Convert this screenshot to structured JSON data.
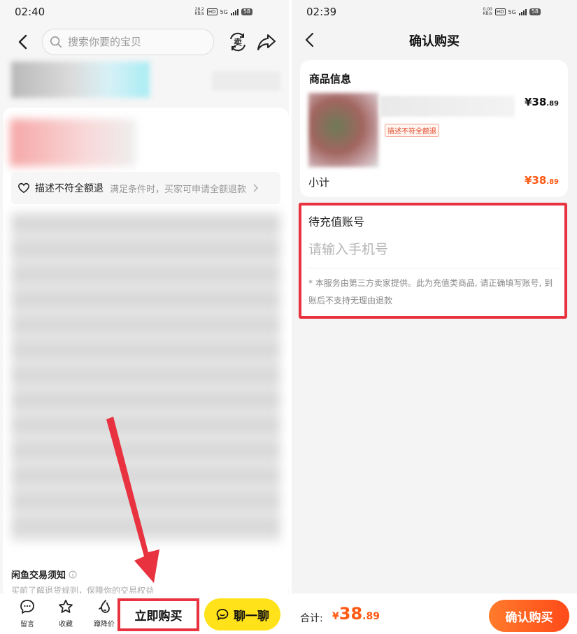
{
  "left": {
    "status": {
      "time": "02:40",
      "speed_top": "28.2",
      "speed_bottom": "KB/s",
      "hd": "HD",
      "net": "5G",
      "battery": "58"
    },
    "search": {
      "placeholder": "搜索你要的宝贝"
    },
    "refund": {
      "title": "描述不符全额退",
      "subtitle": "满足条件时，买家可申请全额退款"
    },
    "notice": {
      "title": "闲鱼交易须知",
      "subtitle": "买前了解退货规则，保障你的交易权益"
    },
    "actions": {
      "comment": "留言",
      "favorite": "收藏",
      "price_drop": "蹲降价"
    },
    "buy_label": "立即购买",
    "chat_label": "聊一聊",
    "colors": {
      "annotation": "#e8323f",
      "chat_yellow": "#ffe21a"
    }
  },
  "right": {
    "status": {
      "time": "02:39",
      "speed_top": "0.00",
      "speed_bottom": "KB/s",
      "hd": "HD",
      "net": "5G",
      "battery": "58"
    },
    "title": "确认购买",
    "goods": {
      "label": "商品信息",
      "price_currency": "¥",
      "price_int": "38",
      "price_dec": ".89",
      "refund_tag": "描述不符全额退"
    },
    "subtotal": {
      "label": "小计",
      "currency": "¥",
      "int": "38",
      "dec": ".89"
    },
    "recharge": {
      "label": "待充值账号",
      "placeholder": "请输入手机号",
      "note": "* 本服务由第三方卖家提供。此为充值类商品, 请正确填写账号, 到账后不支持无理由退款"
    },
    "total": {
      "label": "合计:",
      "currency": "¥",
      "int": "38",
      "dec": ".89"
    },
    "confirm_label": "确认购买",
    "colors": {
      "price_orange": "#ff5a14",
      "annotation": "#e8323f"
    }
  }
}
